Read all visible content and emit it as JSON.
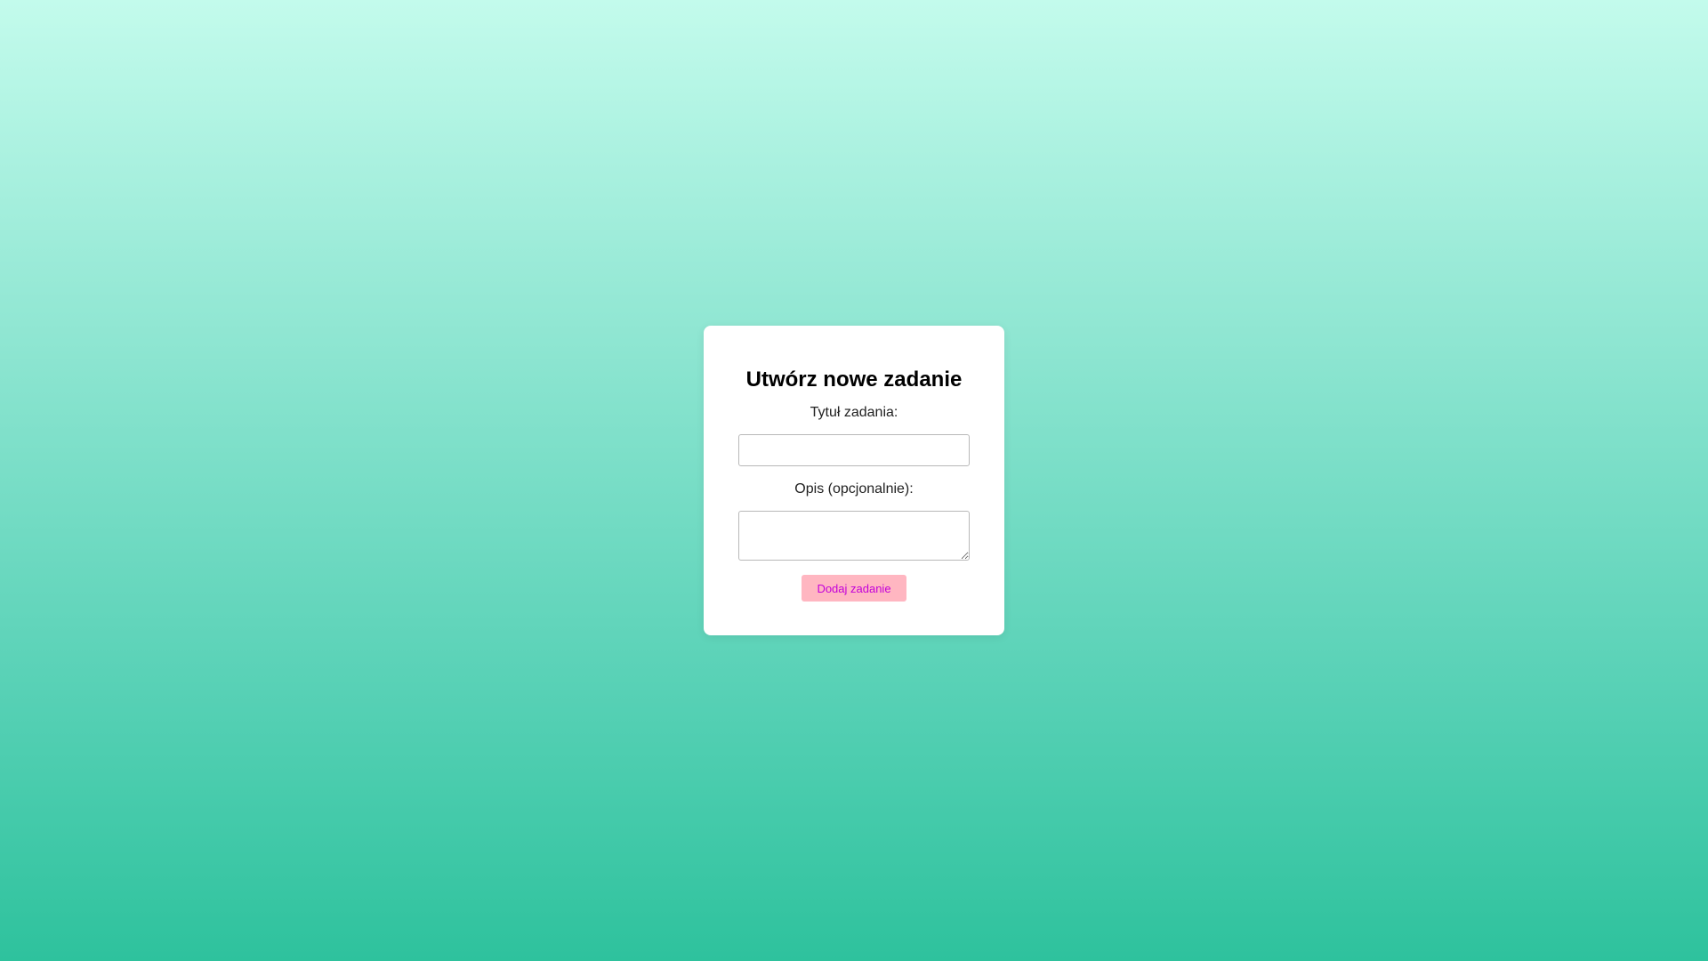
{
  "form": {
    "title": "Utwórz nowe zadanie",
    "task_title_label": "Tytuł zadania:",
    "task_title_value": "",
    "description_label": "Opis (opcjonalnie):",
    "description_value": "",
    "submit_label": "Dodaj zadanie"
  },
  "colors": {
    "background_top": "#c3fbec",
    "background_bottom": "#2ec29d",
    "card": "#ffffff",
    "button_bg": "#ffb6c1",
    "button_text": "#c400d9"
  }
}
